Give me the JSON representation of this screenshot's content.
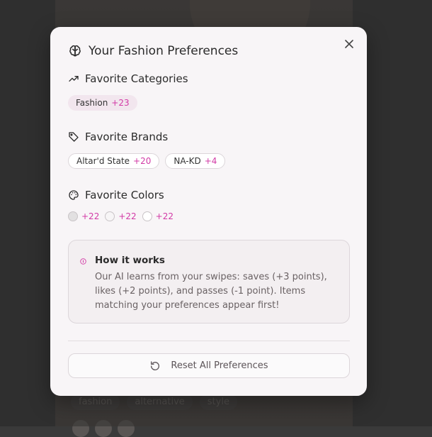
{
  "background": {
    "tags": [
      "fashion",
      "alternative",
      "style"
    ]
  },
  "modal": {
    "title": "Your Fashion Preferences",
    "close_icon": "close-icon",
    "sections": {
      "categories": {
        "title": "Favorite Categories",
        "icon": "trending-up-icon",
        "chips": [
          {
            "label": "Fashion",
            "score": "+23"
          }
        ]
      },
      "brands": {
        "title": "Favorite Brands",
        "icon": "tag-icon",
        "chips": [
          {
            "label": "Altar'd State",
            "score": "+20"
          },
          {
            "label": "NA-KD",
            "score": "+4"
          }
        ]
      },
      "colors": {
        "title": "Favorite Colors",
        "icon": "palette-icon",
        "swatches": [
          {
            "color": "#e2e0e1",
            "score": "+22"
          },
          {
            "color": "#f7f5f6",
            "score": "+22"
          },
          {
            "color": "#ffffff",
            "score": "+22"
          }
        ]
      }
    },
    "info": {
      "title": "How it works",
      "text": "Our AI learns from your swipes: saves (+3 points), likes (+2 points), and passes (-1 point). Items matching your preferences appear first!"
    },
    "reset_button": {
      "label": "Reset All Preferences",
      "icon": "reset-icon"
    }
  },
  "colors": {
    "accent": "#d23aa6",
    "chip_fill": "#f2e6ee"
  }
}
